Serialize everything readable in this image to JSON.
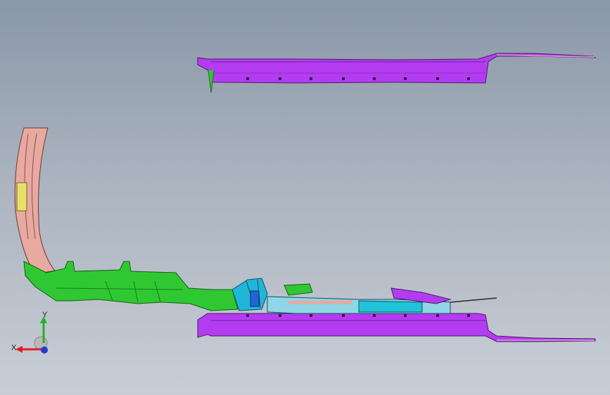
{
  "viewport": {
    "background_top": "#8a97a8",
    "background_bottom": "#c9ced6"
  },
  "model": {
    "parts": [
      {
        "name": "side-sill-upper",
        "color": "#b43cf0"
      },
      {
        "name": "side-sill-lower",
        "color": "#b43cf0"
      },
      {
        "name": "floor-assembly-green",
        "color": "#2fc832"
      },
      {
        "name": "wheel-arch-pink",
        "color": "#e7a9a0"
      },
      {
        "name": "center-tunnel-cyan",
        "color": "#1fb7d6"
      },
      {
        "name": "accent-blue",
        "color": "#2563d9"
      }
    ]
  },
  "triad": {
    "x_label": "X",
    "y_label": "Y",
    "x_color": "#e02020",
    "y_color": "#27b027",
    "z_color": "#1f3fd0"
  }
}
